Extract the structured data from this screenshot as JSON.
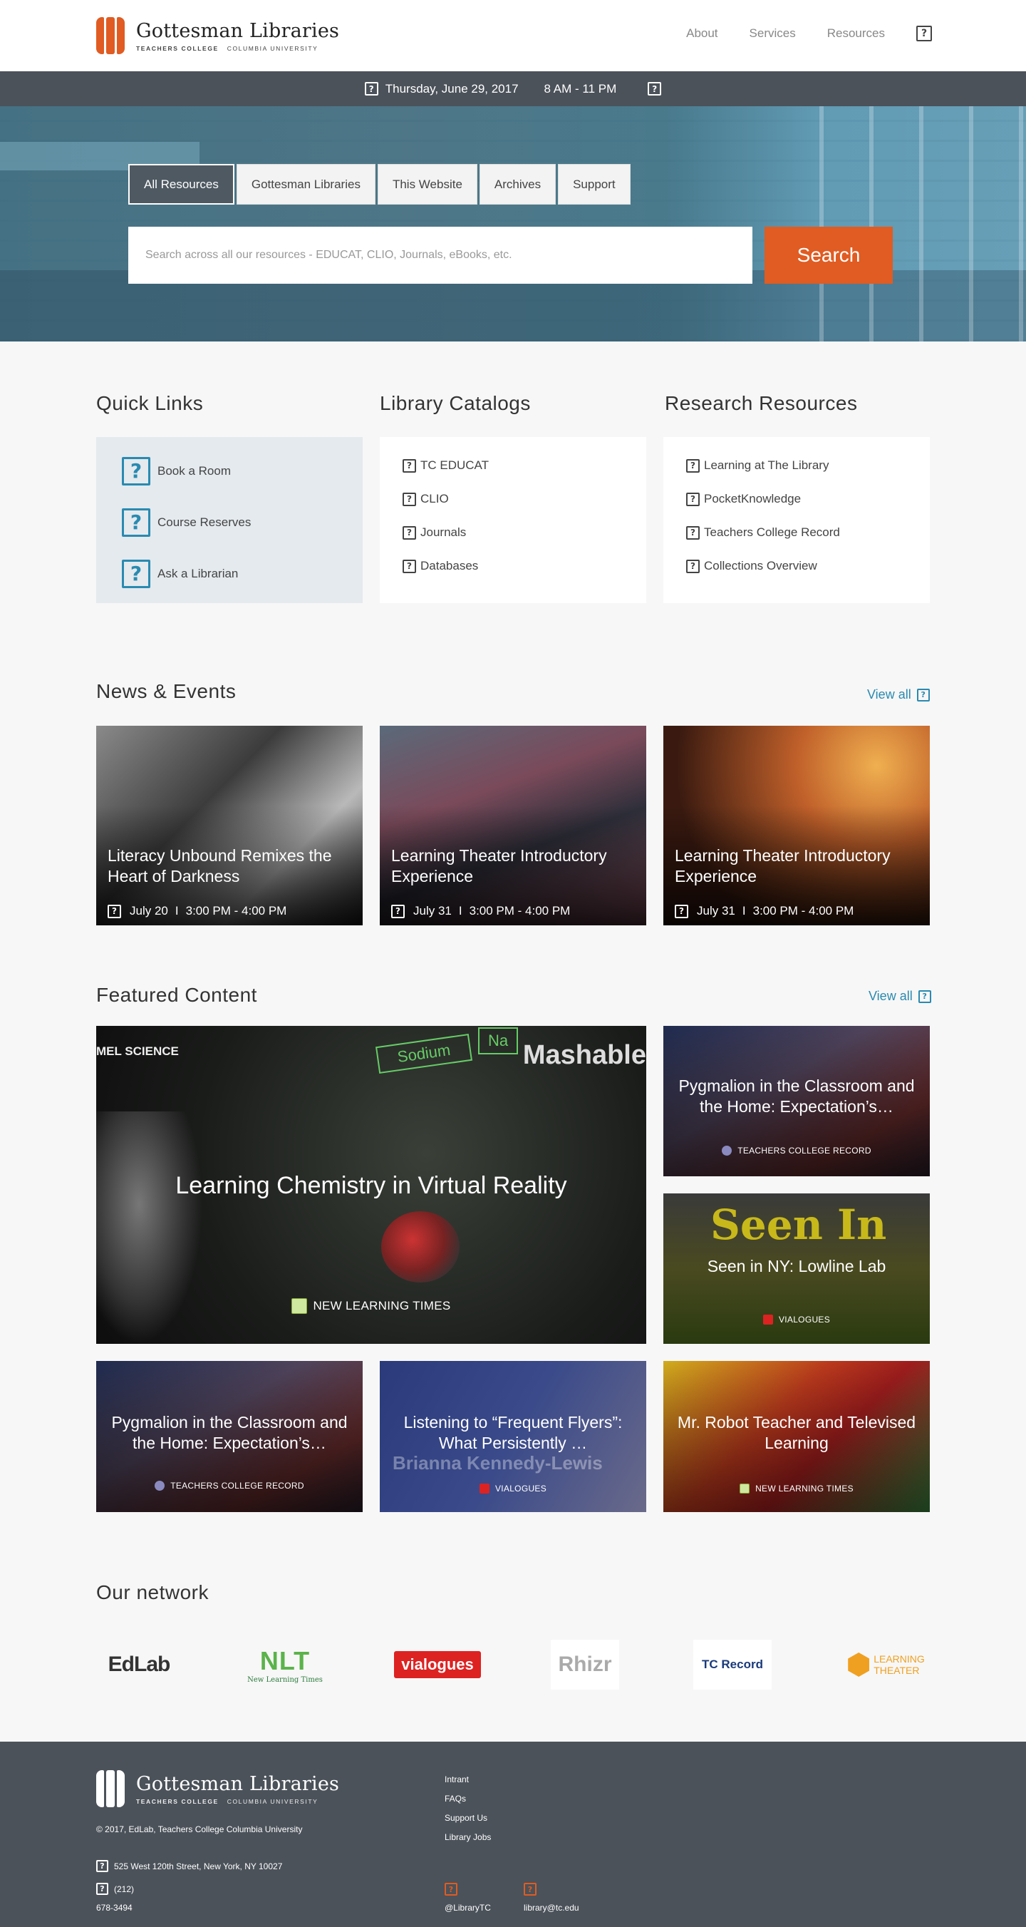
{
  "header": {
    "logo_title": "Gottesman Libraries",
    "logo_sub_bold": "TEACHERS COLLEGE",
    "logo_sub_light": "COLUMBIA UNIVERSITY",
    "nav": [
      "About",
      "Services",
      "Resources"
    ]
  },
  "datebar": {
    "date": "Thursday, June 29, 2017",
    "hours": "8 AM - 11 PM"
  },
  "hero": {
    "tabs": [
      "All Resources",
      "Gottesman Libraries",
      "This Website",
      "Archives",
      "Support"
    ],
    "search_placeholder": "Search across all our resources - EDUCAT, CLIO, Journals, eBooks, etc.",
    "search_button": "Search"
  },
  "quick_links": {
    "title": "Quick Links",
    "items": [
      "Book a Room",
      "Course Reserves",
      "Ask a Librarian"
    ]
  },
  "catalogs": {
    "title": "Library Catalogs",
    "items": [
      "TC EDUCAT",
      "CLIO",
      "Journals",
      "Databases"
    ]
  },
  "research": {
    "title": "Research Resources",
    "items": [
      "Learning at The Library",
      "PocketKnowledge",
      "Teachers College Record",
      "Collections Overview"
    ]
  },
  "news": {
    "title": "News & Events",
    "view_all": "View all",
    "events": [
      {
        "title": "Literacy Unbound Remixes the Heart of Darkness",
        "date": "July 20",
        "time": "3:00 PM - 4:00 PM"
      },
      {
        "title": "Learning Theater Introductory Experience",
        "date": "July 31",
        "time": "3:00 PM - 4:00 PM"
      },
      {
        "title": "Learning Theater Introductory Experience",
        "date": "July 31",
        "time": "3:00 PM - 4:00 PM"
      }
    ]
  },
  "featured": {
    "title": "Featured Content",
    "view_all": "View all",
    "items": [
      {
        "title": "Learning Chemistry in Virtual Reality",
        "source": "NEW LEARNING TIMES",
        "overlay_left": "MEL SCIENCE",
        "overlay_right": "Mashable",
        "label_sodium": "Sodium",
        "label_na": "Na"
      },
      {
        "title": "Pygmalion in the Classroom and the Home: Expectation’s…",
        "source": "TEACHERS COLLEGE RECORD"
      },
      {
        "title": "Seen in NY: Lowline Lab",
        "source": "VIALOGUES",
        "bg_text": "Seen In"
      },
      {
        "title": "Pygmalion in the Classroom and the Home: Expectation’s…",
        "source": "TEACHERS COLLEGE RECORD"
      },
      {
        "title": "Listening to “Frequent Flyers”: What Persistently …",
        "source": "VIALOGUES",
        "bg_text": "Brianna Kennedy-Lewis"
      },
      {
        "title": "Mr. Robot Teacher and Televised Learning",
        "source": "NEW LEARNING TIMES"
      }
    ]
  },
  "network": {
    "title": "Our network",
    "logos": [
      "EdLab",
      "NLT",
      "New Learning Times",
      "vialogues",
      "Rhizr",
      "TC Record",
      "LEARNING",
      "THEATER"
    ]
  },
  "footer": {
    "copyright": "© 2017, EdLab, Teachers College Columbia University",
    "address": "525 West 120th Street, New York, NY 10027",
    "phone_area": "(212)",
    "phone_num": "678-3494",
    "links": [
      "Intrant",
      "FAQs",
      "Support Us",
      "Library Jobs"
    ],
    "social_handle": "@LibraryTC",
    "email": "library@tc.edu"
  },
  "colors": {
    "accent": "#e05c22",
    "link": "#2a8ab0",
    "dark": "#4b525a"
  }
}
